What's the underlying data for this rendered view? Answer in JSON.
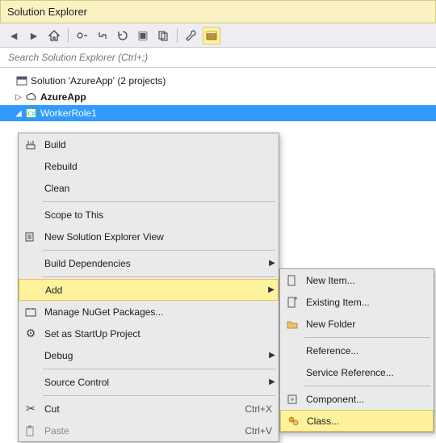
{
  "panel": {
    "title": "Solution Explorer"
  },
  "search": {
    "placeholder": "Search Solution Explorer (Ctrl+;)"
  },
  "tree": {
    "root_label": "Solution 'AzureApp' (2 projects)",
    "project1_label": "AzureApp",
    "project2_label": "WorkerRole1"
  },
  "menu1": {
    "build": "Build",
    "rebuild": "Rebuild",
    "clean": "Clean",
    "scope": "Scope to This",
    "new_view": "New Solution Explorer View",
    "build_deps": "Build Dependencies",
    "add": "Add",
    "nuget": "Manage NuGet Packages...",
    "startup": "Set as StartUp Project",
    "debug": "Debug",
    "source_ctrl": "Source Control",
    "cut": "Cut",
    "cut_kb": "Ctrl+X",
    "paste": "Paste",
    "paste_kb": "Ctrl+V"
  },
  "menu2": {
    "new_item": "New Item...",
    "existing_item": "Existing Item...",
    "new_folder": "New Folder",
    "reference": "Reference...",
    "service_ref": "Service Reference...",
    "component": "Component...",
    "class": "Class..."
  }
}
